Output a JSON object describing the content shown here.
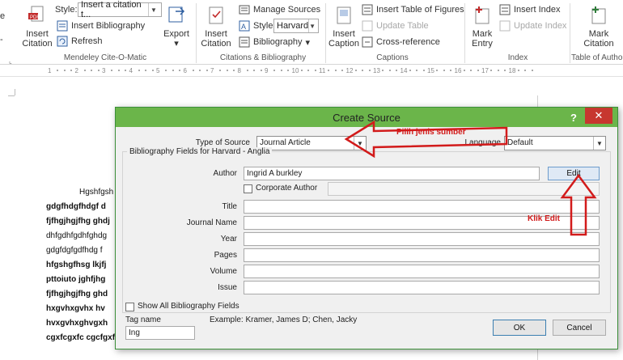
{
  "ribbon": {
    "mendeley": {
      "insert_citation_label_1": "Insert",
      "insert_citation_label_2": "Citation",
      "style_label": "Style:",
      "style_value": "Insert a citation t...",
      "insert_bibliography": "Insert Bibliography",
      "refresh": "Refresh",
      "export": "Export",
      "group_label": "Mendeley Cite-O-Matic"
    },
    "citations": {
      "insert_citation_label_1": "Insert",
      "insert_citation_label_2": "Citation",
      "manage_sources": "Manage Sources",
      "style_label": "Style:",
      "style_value": "Harvard",
      "bibliography": "Bibliography",
      "group_label": "Citations & Bibliography"
    },
    "captions": {
      "insert_caption_1": "Insert",
      "insert_caption_2": "Caption",
      "insert_table_of_figures": "Insert Table of Figures",
      "update_table": "Update Table",
      "cross_reference": "Cross-reference",
      "group_label": "Captions"
    },
    "index": {
      "mark_entry_1": "Mark",
      "mark_entry_2": "Entry",
      "insert_index": "Insert Index",
      "update_index": "Update Index",
      "group_label": "Index"
    },
    "toa": {
      "mark_citation_1": "Mark",
      "mark_citation_2": "Citation",
      "group_label": "Table of Autho"
    },
    "left_fragment_1": "e",
    "left_fragment_2": "-"
  },
  "ruler": {
    "marks": [
      "1",
      "2",
      "3",
      "4",
      "5",
      "6",
      "7",
      "8",
      "9",
      "10",
      "11",
      "12",
      "13",
      "14",
      "15",
      "16",
      "17",
      "18"
    ]
  },
  "document": {
    "lines": [
      {
        "text": "Hgshfgsh",
        "bold": false
      },
      {
        "text": "gdgfhdgfhdgf  d",
        "bold": true
      },
      {
        "text": "fjfhgjhgjfhg ghdj",
        "bold": true
      },
      {
        "text": "dhfgdhfgdhfghdg",
        "bold": false
      },
      {
        "text": "gdgfdgfgdfhdg  f",
        "bold": false
      },
      {
        "text": "hfgshgfhsg lkjfj",
        "bold": true
      },
      {
        "text": "pttoiuto  jghfjhg",
        "bold": true
      },
      {
        "text": "fjfhgjhgjfhg ghd",
        "bold": true
      },
      {
        "text": "hxgvhxgvhx     hv",
        "bold": true
      },
      {
        "text": "hvxgvhxghvgxh",
        "bold": true
      },
      {
        "text": "cgxfcgxfc cgcfgxf",
        "bold": true
      }
    ]
  },
  "dialog": {
    "title": "Create Source",
    "help": "?",
    "close": "✕",
    "type_of_source_label": "Type of Source",
    "type_of_source_value": "Journal Article",
    "language_label": "Language",
    "language_value": "Default",
    "group_title": "Bibliography Fields for Harvard - Anglia",
    "author_label": "Author",
    "author_value": "Ingrid A burkley",
    "edit_button": "Edit",
    "corporate_author_label": "Corporate Author",
    "fields": [
      {
        "label": "Title",
        "value": ""
      },
      {
        "label": "Journal Name",
        "value": ""
      },
      {
        "label": "Year",
        "value": ""
      },
      {
        "label": "Pages",
        "value": ""
      },
      {
        "label": "Volume",
        "value": ""
      },
      {
        "label": "Issue",
        "value": ""
      }
    ],
    "show_all_label": "Show All Bibliography Fields",
    "tag_name_label": "Tag name",
    "tag_name_value": "Ing",
    "example_label": "Example:",
    "example_value": "Kramer, James D; Chen, Jacky",
    "ok_button": "OK",
    "cancel_button": "Cancel"
  },
  "annotations": {
    "source_note": "Pilih jenis sumber",
    "edit_note": "Klik Edit",
    "color": "#d21b1b"
  }
}
